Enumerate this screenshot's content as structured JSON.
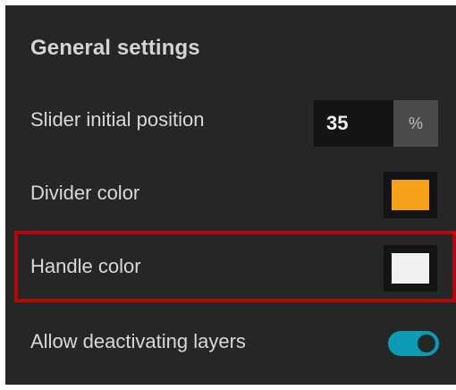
{
  "panel": {
    "title": "General settings"
  },
  "slider_initial_position": {
    "label": "Slider initial position",
    "value": "35",
    "unit": "%"
  },
  "divider_color": {
    "label": "Divider color",
    "color": "#f7a21b"
  },
  "handle_color": {
    "label": "Handle color",
    "color": "#f0f0f0"
  },
  "allow_deactivating_layers": {
    "label": "Allow deactivating layers",
    "enabled": true,
    "accent_color": "#0b9bb5"
  },
  "highlight_color": "#b3070b"
}
